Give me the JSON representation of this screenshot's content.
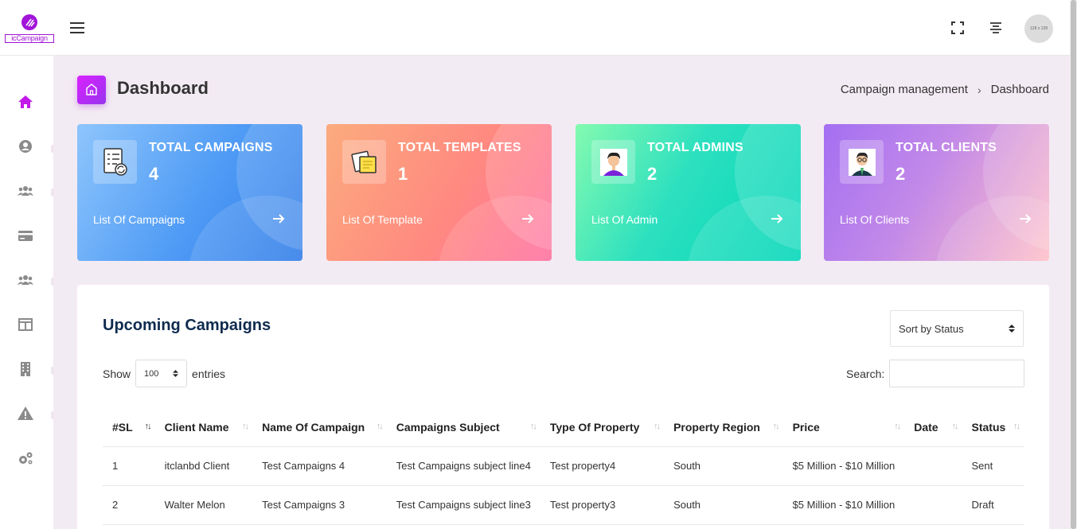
{
  "brand": {
    "logo_text": "icCampaign"
  },
  "topbar": {
    "avatar_text": "128 x 128"
  },
  "header": {
    "title": "Dashboard",
    "breadcrumb": [
      "Campaign management",
      "Dashboard"
    ]
  },
  "cards": [
    {
      "title": "TOTAL CAMPAIGNS",
      "count": "4",
      "link": "List Of Campaigns"
    },
    {
      "title": "TOTAL TEMPLATES",
      "count": "1",
      "link": "List Of Template"
    },
    {
      "title": "TOTAL ADMINS",
      "count": "2",
      "link": "List Of Admin"
    },
    {
      "title": "TOTAL CLIENTS",
      "count": "2",
      "link": "List Of Clients"
    }
  ],
  "table_panel": {
    "title": "Upcoming Campaigns",
    "sort_select": "Sort by Status",
    "show_label": "Show",
    "entries_value": "100",
    "entries_label": "entries",
    "search_label": "Search:",
    "columns": [
      "#SL",
      "Client Name",
      "Name Of Campaign",
      "Campaigns Subject",
      "Type Of Property",
      "Property Region",
      "Price",
      "Date",
      "Status"
    ],
    "rows": [
      [
        "1",
        "itclanbd Client",
        "Test Campaigns 4",
        "Test Campaigns subject line4",
        "Test property4",
        "South",
        "$5 Million - $10 Million",
        "",
        "Sent"
      ],
      [
        "2",
        "Walter Melon",
        "Test Campaigns 3",
        "Test Campaigns subject line3",
        "Test property3",
        "South",
        "$5 Million - $10 Million",
        "",
        "Draft"
      ]
    ]
  },
  "colors": {
    "accent": "#c21ae8",
    "title_navy": "#0f2b4e",
    "sidebar_icon": "#8b8b8b"
  }
}
